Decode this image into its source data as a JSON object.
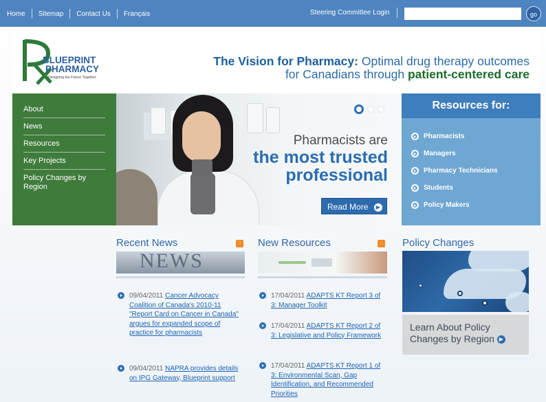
{
  "topbar": {
    "links": [
      "Home",
      "Sitemap",
      "Contact Us",
      "Français"
    ],
    "login": "Steering Committee Login",
    "search_placeholder": "",
    "go": "go"
  },
  "logo": {
    "line1": "BLUEPRINT",
    "line2": "PHARMACY",
    "subtitle": "Designing the Future Together"
  },
  "header": {
    "vision_label": "The Vision for Pharmacy:",
    "vision_text1": "Optimal drug therapy outcomes",
    "vision_text2": "for Canadians through",
    "vision_emph": "patient-centered care"
  },
  "leftnav": {
    "items": [
      "About",
      "News",
      "Resources",
      "Key Projects",
      "Policy Changes by Region"
    ]
  },
  "hero": {
    "line1": "Pharmacists are",
    "line2": "the most trusted",
    "line3": "professional",
    "read_more": "Read More"
  },
  "resources": {
    "title": "Resources for:",
    "items": [
      "Pharmacists",
      "Managers",
      "Pharmacy Technicians",
      "Students",
      "Policy Makers"
    ]
  },
  "recent_news": {
    "title": "Recent News",
    "banner": "NEWS",
    "entries": [
      {
        "date": "09/04/2011",
        "text": "Cancer Advocacy Coalition of Canada's 2010-11 \"Report Card on Cancer in Canada\" argues for expanded scope of practice for pharmacists"
      },
      {
        "date": "09/04/2011",
        "text": "NAPRA provides details on IPG Gateway, Blueprint support"
      }
    ]
  },
  "new_resources": {
    "title": "New Resources",
    "entries": [
      {
        "date": "17/04/2011",
        "text": "ADAPTS KT Report 3 of 3: Manager Toolkit"
      },
      {
        "date": "17/04/2011",
        "text": "ADAPTS KT Report 2 of 3: Legislative and Policy Framework"
      },
      {
        "date": "17/04/2011",
        "text": "ADAPTS KT Report 1 of 3: Environmental Scan, Gap Identification, and Recommended Priorities"
      }
    ]
  },
  "policy": {
    "title": "Policy Changes",
    "box_line1": "Learn About Policy",
    "box_line2": "Changes by Region"
  },
  "colors": {
    "topbar": "#4e84bf",
    "nav_green": "#3f7b3b",
    "accent_blue": "#2a6db0",
    "resources_panel": "#6fa7d3"
  }
}
